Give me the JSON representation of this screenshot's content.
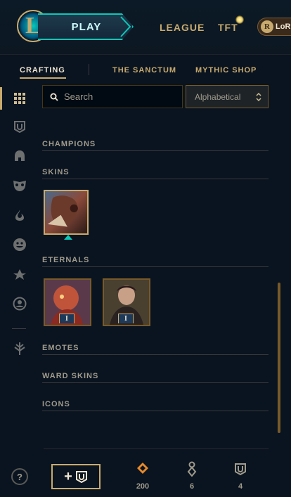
{
  "header": {
    "logo_letter": "L",
    "play_label": "PLAY",
    "nav": [
      "LEAGUE",
      "TFT"
    ],
    "lor_label": "LoR"
  },
  "subnav": {
    "tabs": [
      "CRAFTING",
      "THE SANCTUM",
      "MYTHIC SHOP"
    ],
    "active": "CRAFTING"
  },
  "rail": {
    "items": [
      "grid-icon",
      "chest-icon",
      "champion-helmet-icon",
      "skin-mask-icon",
      "ward-fire-icon",
      "emote-face-icon",
      "eternals-icon",
      "summoner-icon-icon",
      "clash-icon"
    ]
  },
  "search": {
    "placeholder": "Search"
  },
  "sort": {
    "value": "Alphabetical"
  },
  "sections": {
    "champions": "CHAMPIONS",
    "skins": "SKINS",
    "eternals": "ETERNALS",
    "emotes": "EMOTES",
    "ward_skins": "WARD SKINS",
    "icons": "ICONS"
  },
  "eternals_tiles": [
    {
      "badge": "I"
    },
    {
      "badge": "I"
    }
  ],
  "footer": {
    "help": "?",
    "add_label": "+",
    "currencies": [
      {
        "name": "orange-essence-icon",
        "value": "200"
      },
      {
        "name": "key-fragment-icon",
        "value": "6"
      },
      {
        "name": "chest-icon",
        "value": "4"
      }
    ]
  },
  "colors": {
    "gold": "#c8aa6e",
    "teal": "#0ac8b9",
    "background": "#0a1420"
  }
}
